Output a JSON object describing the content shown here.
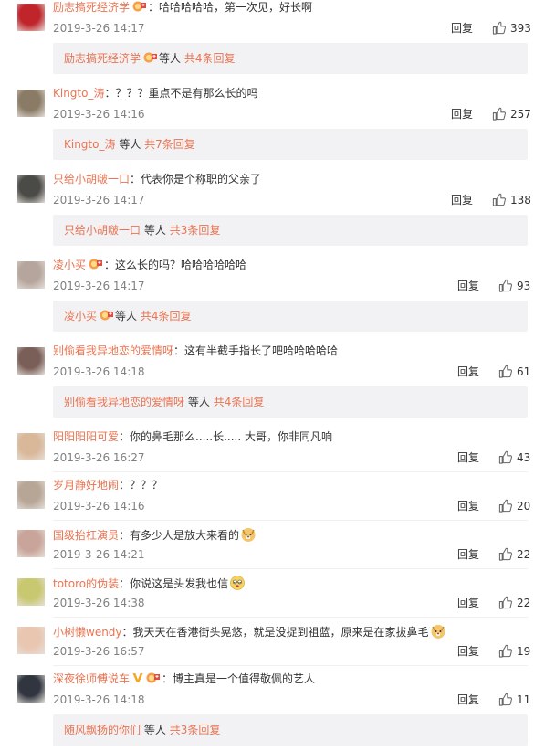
{
  "comments": [
    {
      "user": "励志搞死经济学",
      "text": "：哈哈哈哈哈，第一次见，好长啊",
      "time": "2019-3-26 14:17",
      "reply": "回复",
      "likes": "393",
      "avatar_color": "#c0252b",
      "badge": true,
      "replies": {
        "user": "励志搞死经济学",
        "mid": "等人",
        "more": "共4条回复",
        "badge": true
      }
    },
    {
      "user": "Kingto_涛",
      "text": "：？？？重点不是有那么长的吗",
      "time": "2019-3-26 14:16",
      "reply": "回复",
      "likes": "257",
      "avatar_color": "#8a7b66",
      "replies": {
        "user": "Kingto_涛",
        "mid": "等人",
        "more": "共7条回复"
      }
    },
    {
      "user": "只给小胡啵一口",
      "text": "：代表你是个称职的父亲了",
      "time": "2019-3-26 14:17",
      "reply": "回复",
      "likes": "138",
      "avatar_color": "#4a4a46",
      "replies": {
        "user": "只给小胡啵一口",
        "mid": "等人",
        "more": "共3条回复"
      }
    },
    {
      "user": "凌小买",
      "text": "：这么长的吗？哈哈哈哈哈哈",
      "time": "2019-3-26 14:17",
      "reply": "回复",
      "likes": "93",
      "avatar_color": "#b5a59c",
      "badge": true,
      "replies": {
        "user": "凌小买",
        "mid": "等人",
        "more": "共4条回复",
        "badge": true
      }
    },
    {
      "user": "别偷看我异地恋的爱情呀",
      "text": "：这有半截手指长了吧哈哈哈哈哈",
      "time": "2019-3-26 14:18",
      "reply": "回复",
      "likes": "61",
      "avatar_color": "#7a5e58",
      "replies": {
        "user": "别偷看我异地恋的爱情呀",
        "mid": "等人",
        "more": "共4条回复"
      }
    },
    {
      "user": "阳阳阳阳可爱",
      "text": "：你的鼻毛那么.....长.....  大哥，你非同凡响",
      "time": "2019-3-26 16:27",
      "reply": "回复",
      "likes": "43",
      "avatar_color": "#d9b89a"
    },
    {
      "user": "岁月静好地闹",
      "text": "：？？？",
      "time": "2019-3-26 14:16",
      "reply": "回复",
      "likes": "20",
      "avatar_color": "#b7a596"
    },
    {
      "user": "国级抬杠演员",
      "text": "：有多少人是放大来看的",
      "time": "2019-3-26 14:21",
      "reply": "回复",
      "likes": "22",
      "avatar_color": "#c9a49a",
      "emoji": "doge"
    },
    {
      "user": "totoro的伪装",
      "text": "：你说这是头发我也信",
      "time": "2019-3-26 14:38",
      "reply": "回复",
      "likes": "22",
      "avatar_color": "#c8c870",
      "emoji": "dizzy"
    },
    {
      "user": "小树懒wendy",
      "text": "：我天天在香港街头晃悠，就是没捉到祖蓝，原来是在家拔鼻毛",
      "time": "2019-3-26 16:57",
      "reply": "回复",
      "likes": "19",
      "avatar_color": "#e9c6b0",
      "emoji": "doge"
    },
    {
      "user": "深夜徐师傅说车",
      "text": "：博主真是一个值得敬佩的艺人",
      "time": "2019-3-26 14:18",
      "reply": "回复",
      "likes": "11",
      "avatar_color": "#303540",
      "vip": true,
      "badge": true,
      "replies": {
        "user": "随风飘扬的你们",
        "mid": "等人",
        "more": "共3条回复"
      }
    }
  ],
  "colors": {
    "accent": "#eb7350",
    "meta": "#808080",
    "reply_bg": "#f2f2f5"
  }
}
